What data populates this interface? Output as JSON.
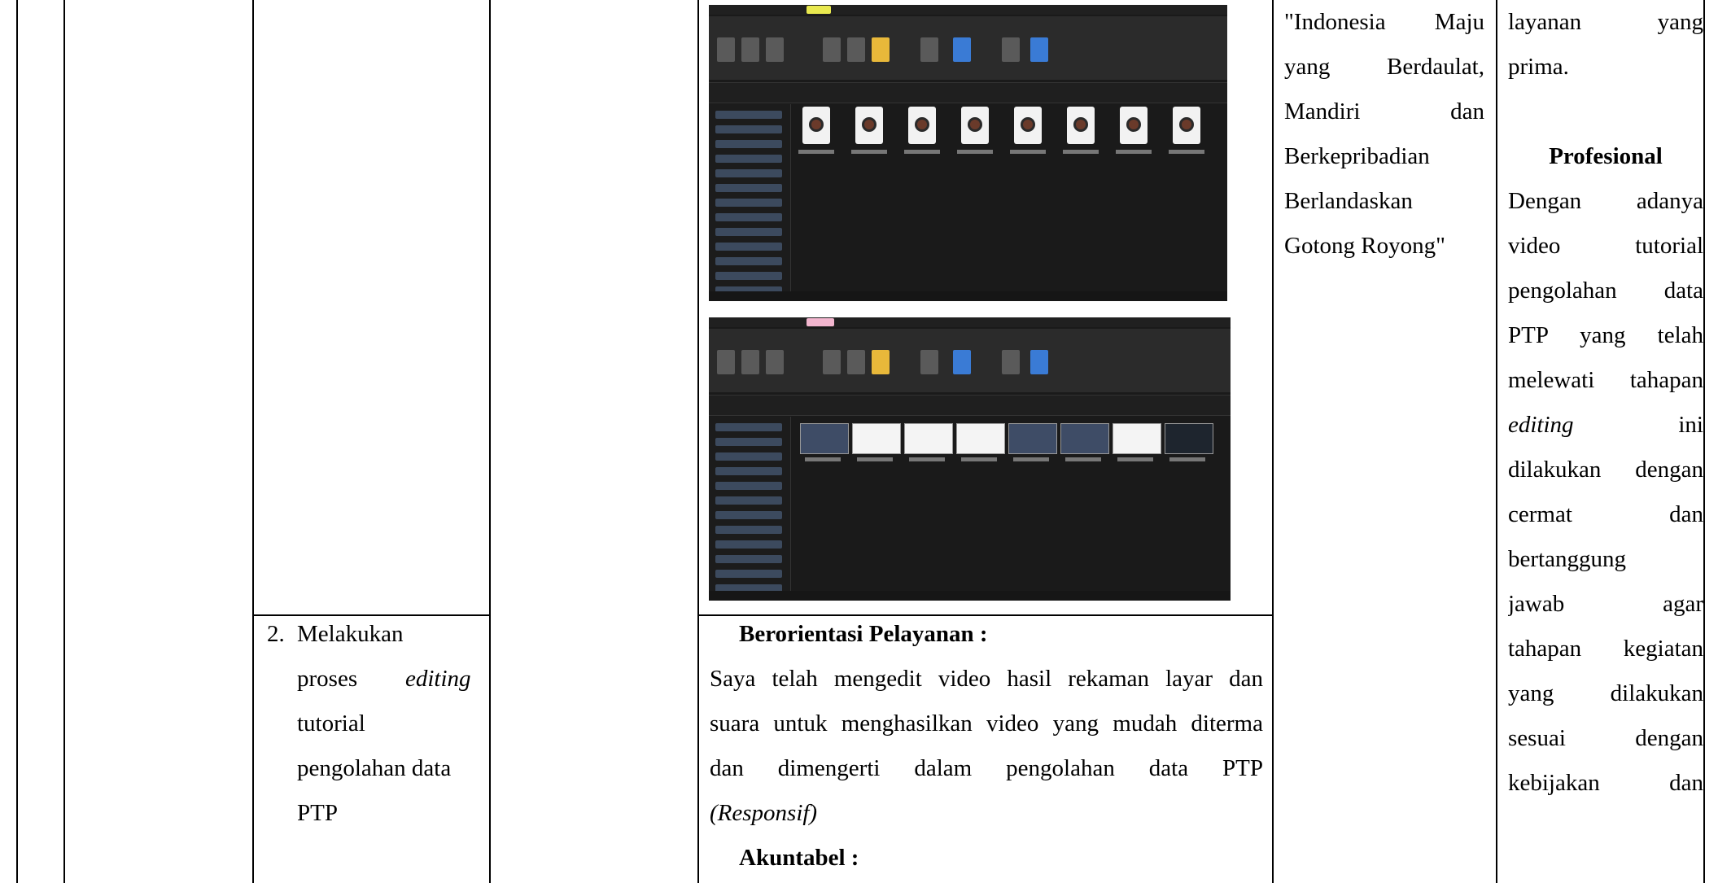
{
  "activity": {
    "number": "2.",
    "lines": [
      "Melakukan",
      "tutorial",
      "pengolahan data",
      "PTP"
    ],
    "editing_prefix": "proses",
    "editing_word": "editing"
  },
  "screenshot_top": {
    "name": "file-explorer-window",
    "file_count": 8
  },
  "screenshot_bottom": {
    "name": "file-explorer-window-videos",
    "file_count": 8
  },
  "output": {
    "heading1": "Berorientasi Pelayanan :",
    "body_lines": [
      "Saya telah mengedit video hasil rekaman layar dan",
      "suara untuk menghasilkan video yang mudah diterma",
      "dan dimengerti dalam pengolahan data PTP"
    ],
    "responsif": "(Responsif)",
    "heading2": "Akuntabel :"
  },
  "vision": {
    "lines": [
      "\"Indonesia Maju",
      "yang Berdaulat,",
      "Mandiri dan",
      "Berkepribadian",
      "Berlandaskan",
      "Gotong Royong\""
    ]
  },
  "values": {
    "lines_top": [
      "layanan yang",
      "prima."
    ],
    "heading": "Profesional",
    "lines": [
      "Dengan adanya",
      "video tutorial",
      "pengolahan data",
      "PTP yang telah",
      "melewati tahapan",
      "editing ini",
      "dilakukan dengan",
      "cermat dan",
      "bertanggung",
      "jawab agar",
      "tahapan kegiatan",
      "yang dilakukan",
      "sesuai dengan",
      "kebijakan dan"
    ]
  }
}
